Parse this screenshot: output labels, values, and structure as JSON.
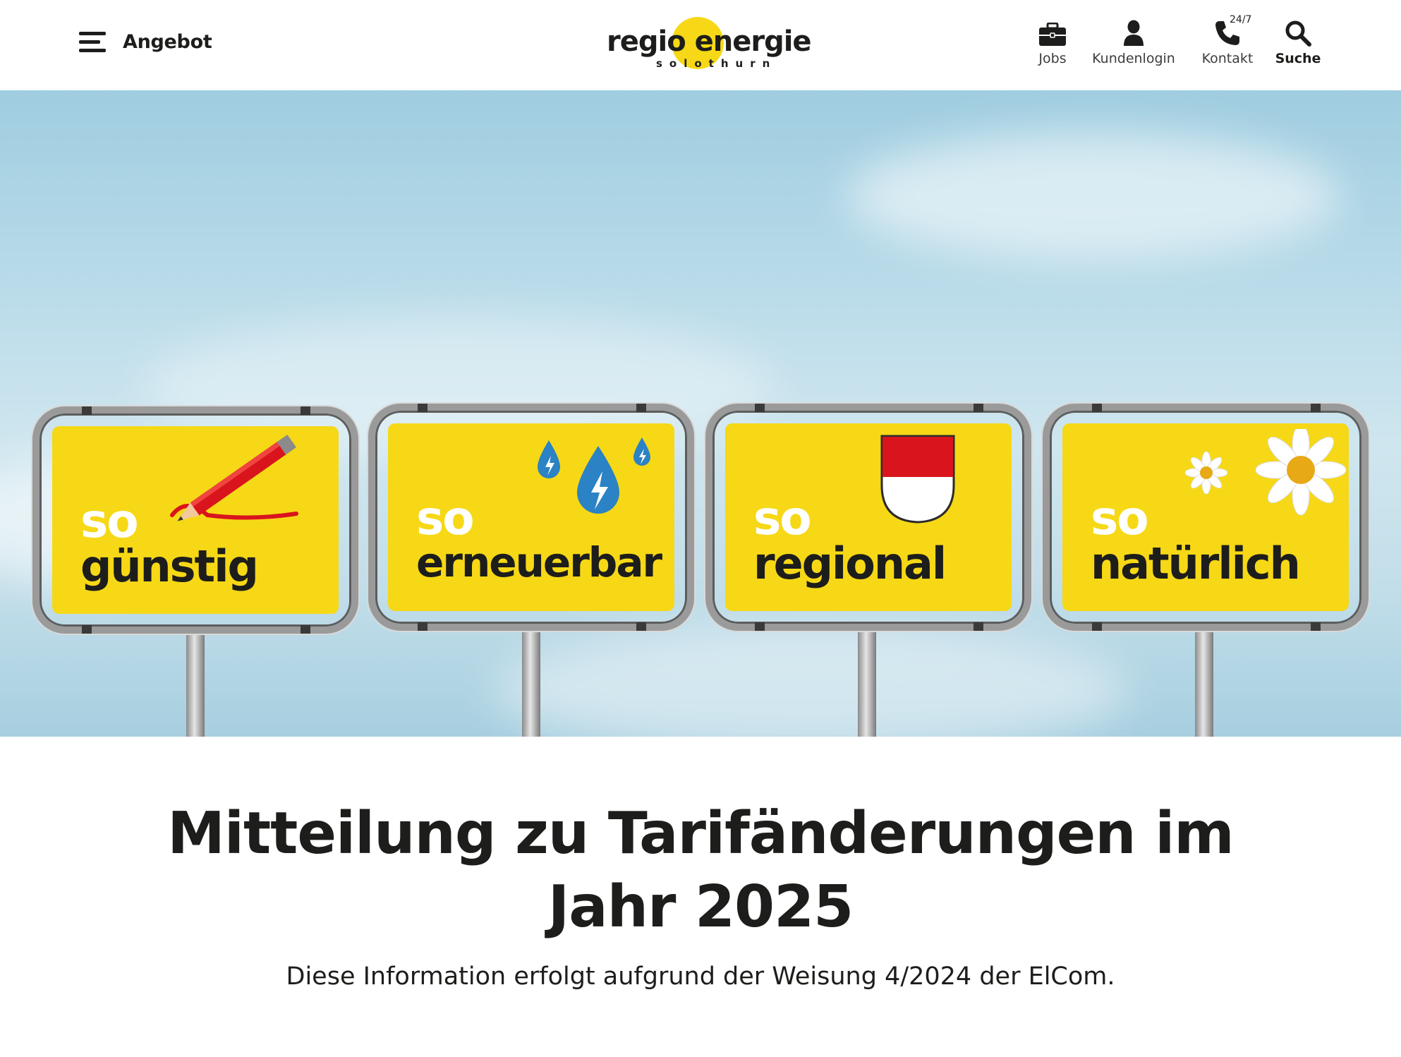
{
  "header": {
    "menu_label": "Angebot",
    "logo": {
      "wordmark": "regio energie",
      "city": "solothurn"
    },
    "utility": [
      {
        "label": "Jobs",
        "icon": "briefcase-icon"
      },
      {
        "label": "Kundenlogin",
        "icon": "user-icon"
      },
      {
        "label": "Kontakt",
        "icon": "phone-icon",
        "badge": "24/7"
      },
      {
        "label": "Suche",
        "icon": "search-icon"
      }
    ]
  },
  "hero": {
    "signs": [
      {
        "prefix": "so",
        "word": "günstig",
        "icon": "pencil-icon"
      },
      {
        "prefix": "so",
        "word": "erneuerbar",
        "icon": "water-drop-bolt-icon"
      },
      {
        "prefix": "so",
        "word": "regional",
        "icon": "coat-of-arms-icon"
      },
      {
        "prefix": "so",
        "word": "natürlich",
        "icon": "daisy-icon"
      }
    ]
  },
  "article": {
    "title": "Mitteilung zu Tarifänderungen im Jahr 2025",
    "lead": "Diese Information erfolgt aufgrund der Weisung 4/2024 der ElCom."
  },
  "colors": {
    "brand_yellow": "#f6d816",
    "text": "#1d1d1b",
    "shield_red": "#d9141d"
  }
}
